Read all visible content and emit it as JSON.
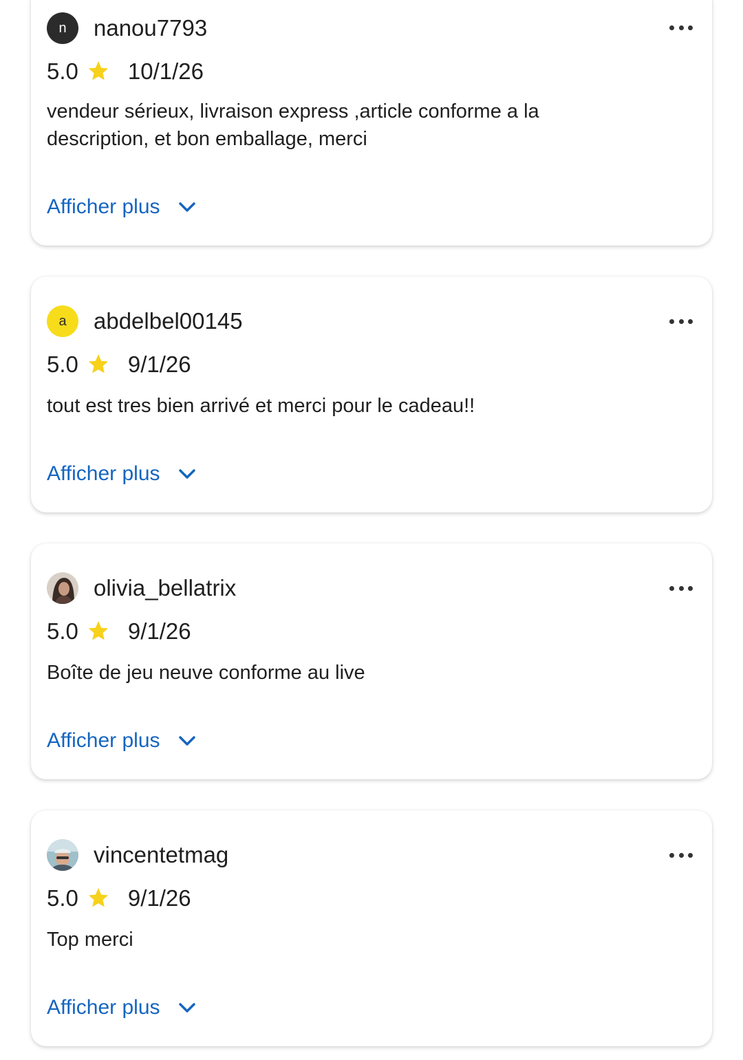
{
  "reviews": [
    {
      "initial": "n",
      "username": "nanou7793",
      "rating": "5.0",
      "date": "10/1/26",
      "text": "vendeur sérieux, livraison express ,article conforme a la description, et bon emballage, merci",
      "more_label": "Afficher plus"
    },
    {
      "initial": "a",
      "username": "abdelbel00145",
      "rating": "5.0",
      "date": "9/1/26",
      "text": "tout est tres bien arrivé et merci pour le cadeau!!",
      "more_label": "Afficher plus"
    },
    {
      "username": "olivia_bellatrix",
      "rating": "5.0",
      "date": "9/1/26",
      "text": "Boîte de jeu neuve conforme au live",
      "more_label": "Afficher plus"
    },
    {
      "username": "vincentetmag",
      "rating": "5.0",
      "date": "9/1/26",
      "text": "Top merci",
      "more_label": "Afficher plus"
    }
  ],
  "colors": {
    "link": "#1565c0",
    "star": "#f7d11b"
  },
  "icons": {
    "star": "star-icon",
    "chevron": "chevron-down-icon",
    "more": "more-horizontal-icon"
  }
}
